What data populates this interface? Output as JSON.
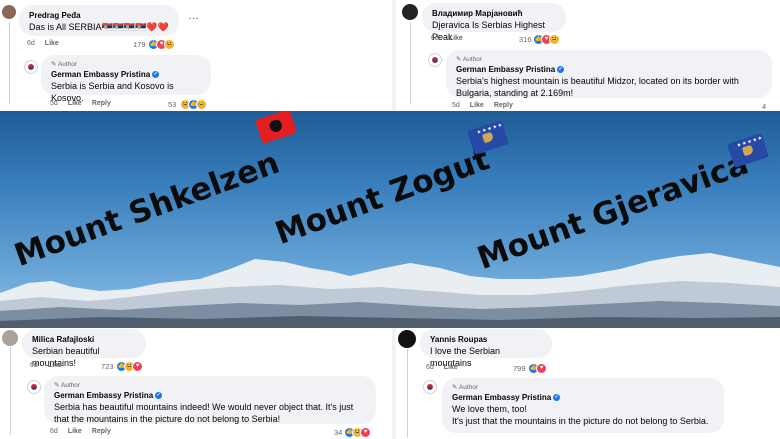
{
  "top_left": {
    "comment": {
      "author": "Predrag Peđa",
      "text": "Das is All SERBIA🇷🇸🇷🇸🇷🇸🇷🇸❤️❤️",
      "time": "6d",
      "like": "Like",
      "reaction_count": "179"
    },
    "more": "…",
    "reply": {
      "badge": "Author",
      "author": "German Embassy Pristina",
      "text": "Serbia is Serbia and Kosovo is Kosovo.",
      "time": "5d",
      "like": "Like",
      "reply": "Reply",
      "reaction_count": "53"
    }
  },
  "top_right": {
    "comment": {
      "author": "Владимир Марјановић",
      "text": "Djeravica Is Serbias Highest Peak",
      "time": "6d",
      "like": "Like",
      "reaction_count": "316"
    },
    "reply": {
      "badge": "Author",
      "author": "German Embassy Pristina",
      "text": "Serbia's highest mountain is beautiful Midzor, located on its border with Bulgaria, standing at 2.169m!",
      "time": "5d",
      "like": "Like",
      "reply": "Reply",
      "reaction_count": "4"
    }
  },
  "photo": {
    "labels": [
      "Mount Shkelzen",
      "Mount Zogut",
      "Mount Gjeravica"
    ],
    "colors": {
      "albania_flag": "#e41e20",
      "kosovo_flag": "#244aa5",
      "kosovo_gold": "#d0a650"
    }
  },
  "bottom_left": {
    "comment": {
      "author": "Milica Rafajloski",
      "text": "Serbian beautiful mountains!",
      "time": "6d",
      "like": "Like",
      "reaction_count": "723"
    },
    "reply": {
      "badge": "Author",
      "author": "German Embassy Pristina",
      "text": "Serbia has beautiful mountains indeed! We would never object that. It's just that the mountains in the picture do not belong to Serbia!",
      "time": "6d",
      "like": "Like",
      "reply": "Reply",
      "reaction_count": "34"
    }
  },
  "bottom_right": {
    "comment": {
      "author": "Yannis Roupas",
      "text": "I love the Serbian mountains",
      "time": "6d",
      "like": "Like",
      "reaction_count": "799"
    },
    "reply": {
      "badge": "Author",
      "author": "German Embassy Pristina",
      "text_line1": "We love them, too!",
      "text_line2": "It's just that the mountains in the picture do not belong to Serbia."
    }
  }
}
